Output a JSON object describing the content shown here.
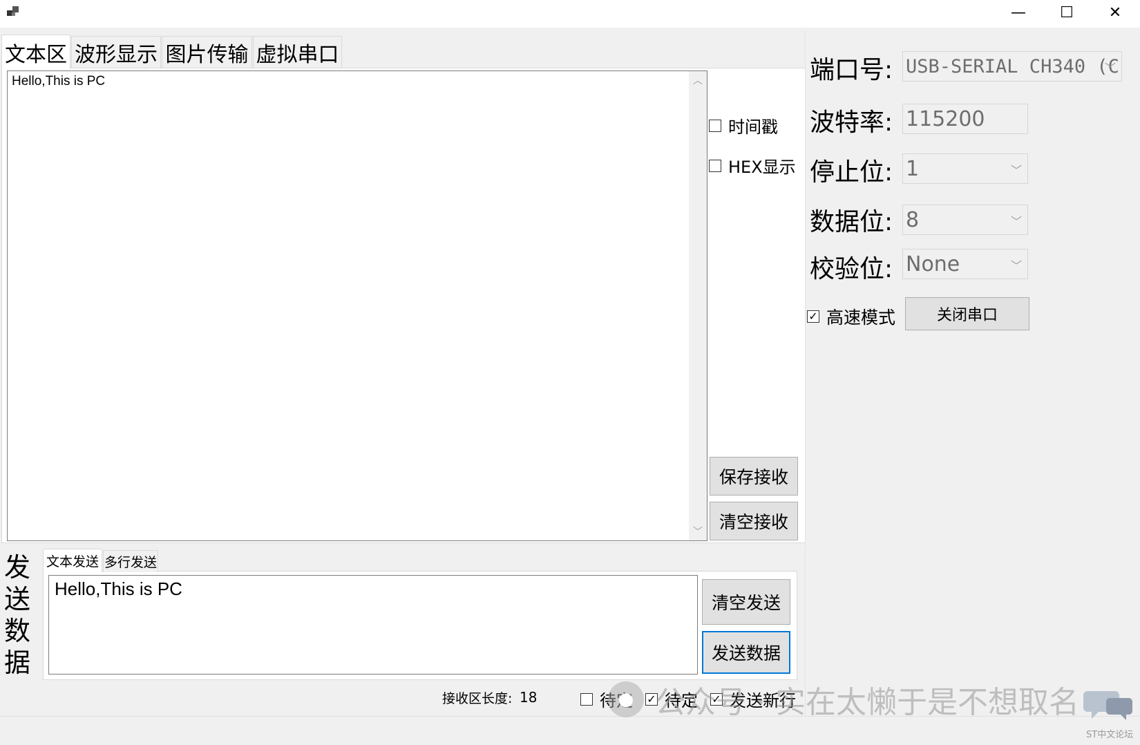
{
  "window": {
    "min_symbol": "—",
    "max_symbol": "☐",
    "close_symbol": "✕"
  },
  "tabs": [
    {
      "label": "文本区"
    },
    {
      "label": "波形显示"
    },
    {
      "label": "图片传输"
    },
    {
      "label": "虚拟串口"
    }
  ],
  "receive": {
    "text": "Hello,This is PC",
    "timestamp_label": "时间戳",
    "hex_label": "HEX显示",
    "save_label": "保存接收",
    "clear_label": "清空接收"
  },
  "send": {
    "section_label": "发送数据",
    "tabs": [
      {
        "label": "文本发送"
      },
      {
        "label": "多行发送"
      }
    ],
    "text": "Hello,This is PC",
    "clear_label": "清空发送",
    "send_label": "发送数据"
  },
  "status": {
    "recv_len_label": "接收区长度:",
    "recv_len_value": "18",
    "pending1_label": "待定",
    "pending2_label": "待定",
    "newline_label": "发送新行"
  },
  "config": {
    "port_label": "端口号:",
    "port_value": "USB-SERIAL CH340 (C",
    "baud_label": "波特率:",
    "baud_value": "115200",
    "stop_label": "停止位:",
    "stop_value": "1",
    "data_label": "数据位:",
    "data_value": "8",
    "parity_label": "校验位:",
    "parity_value": "None",
    "highspeed_label": "高速模式",
    "close_port_label": "关闭串口"
  },
  "watermark": {
    "text": "公众号 · 实在太懒于是不想取名",
    "site": "ST中文论坛"
  }
}
